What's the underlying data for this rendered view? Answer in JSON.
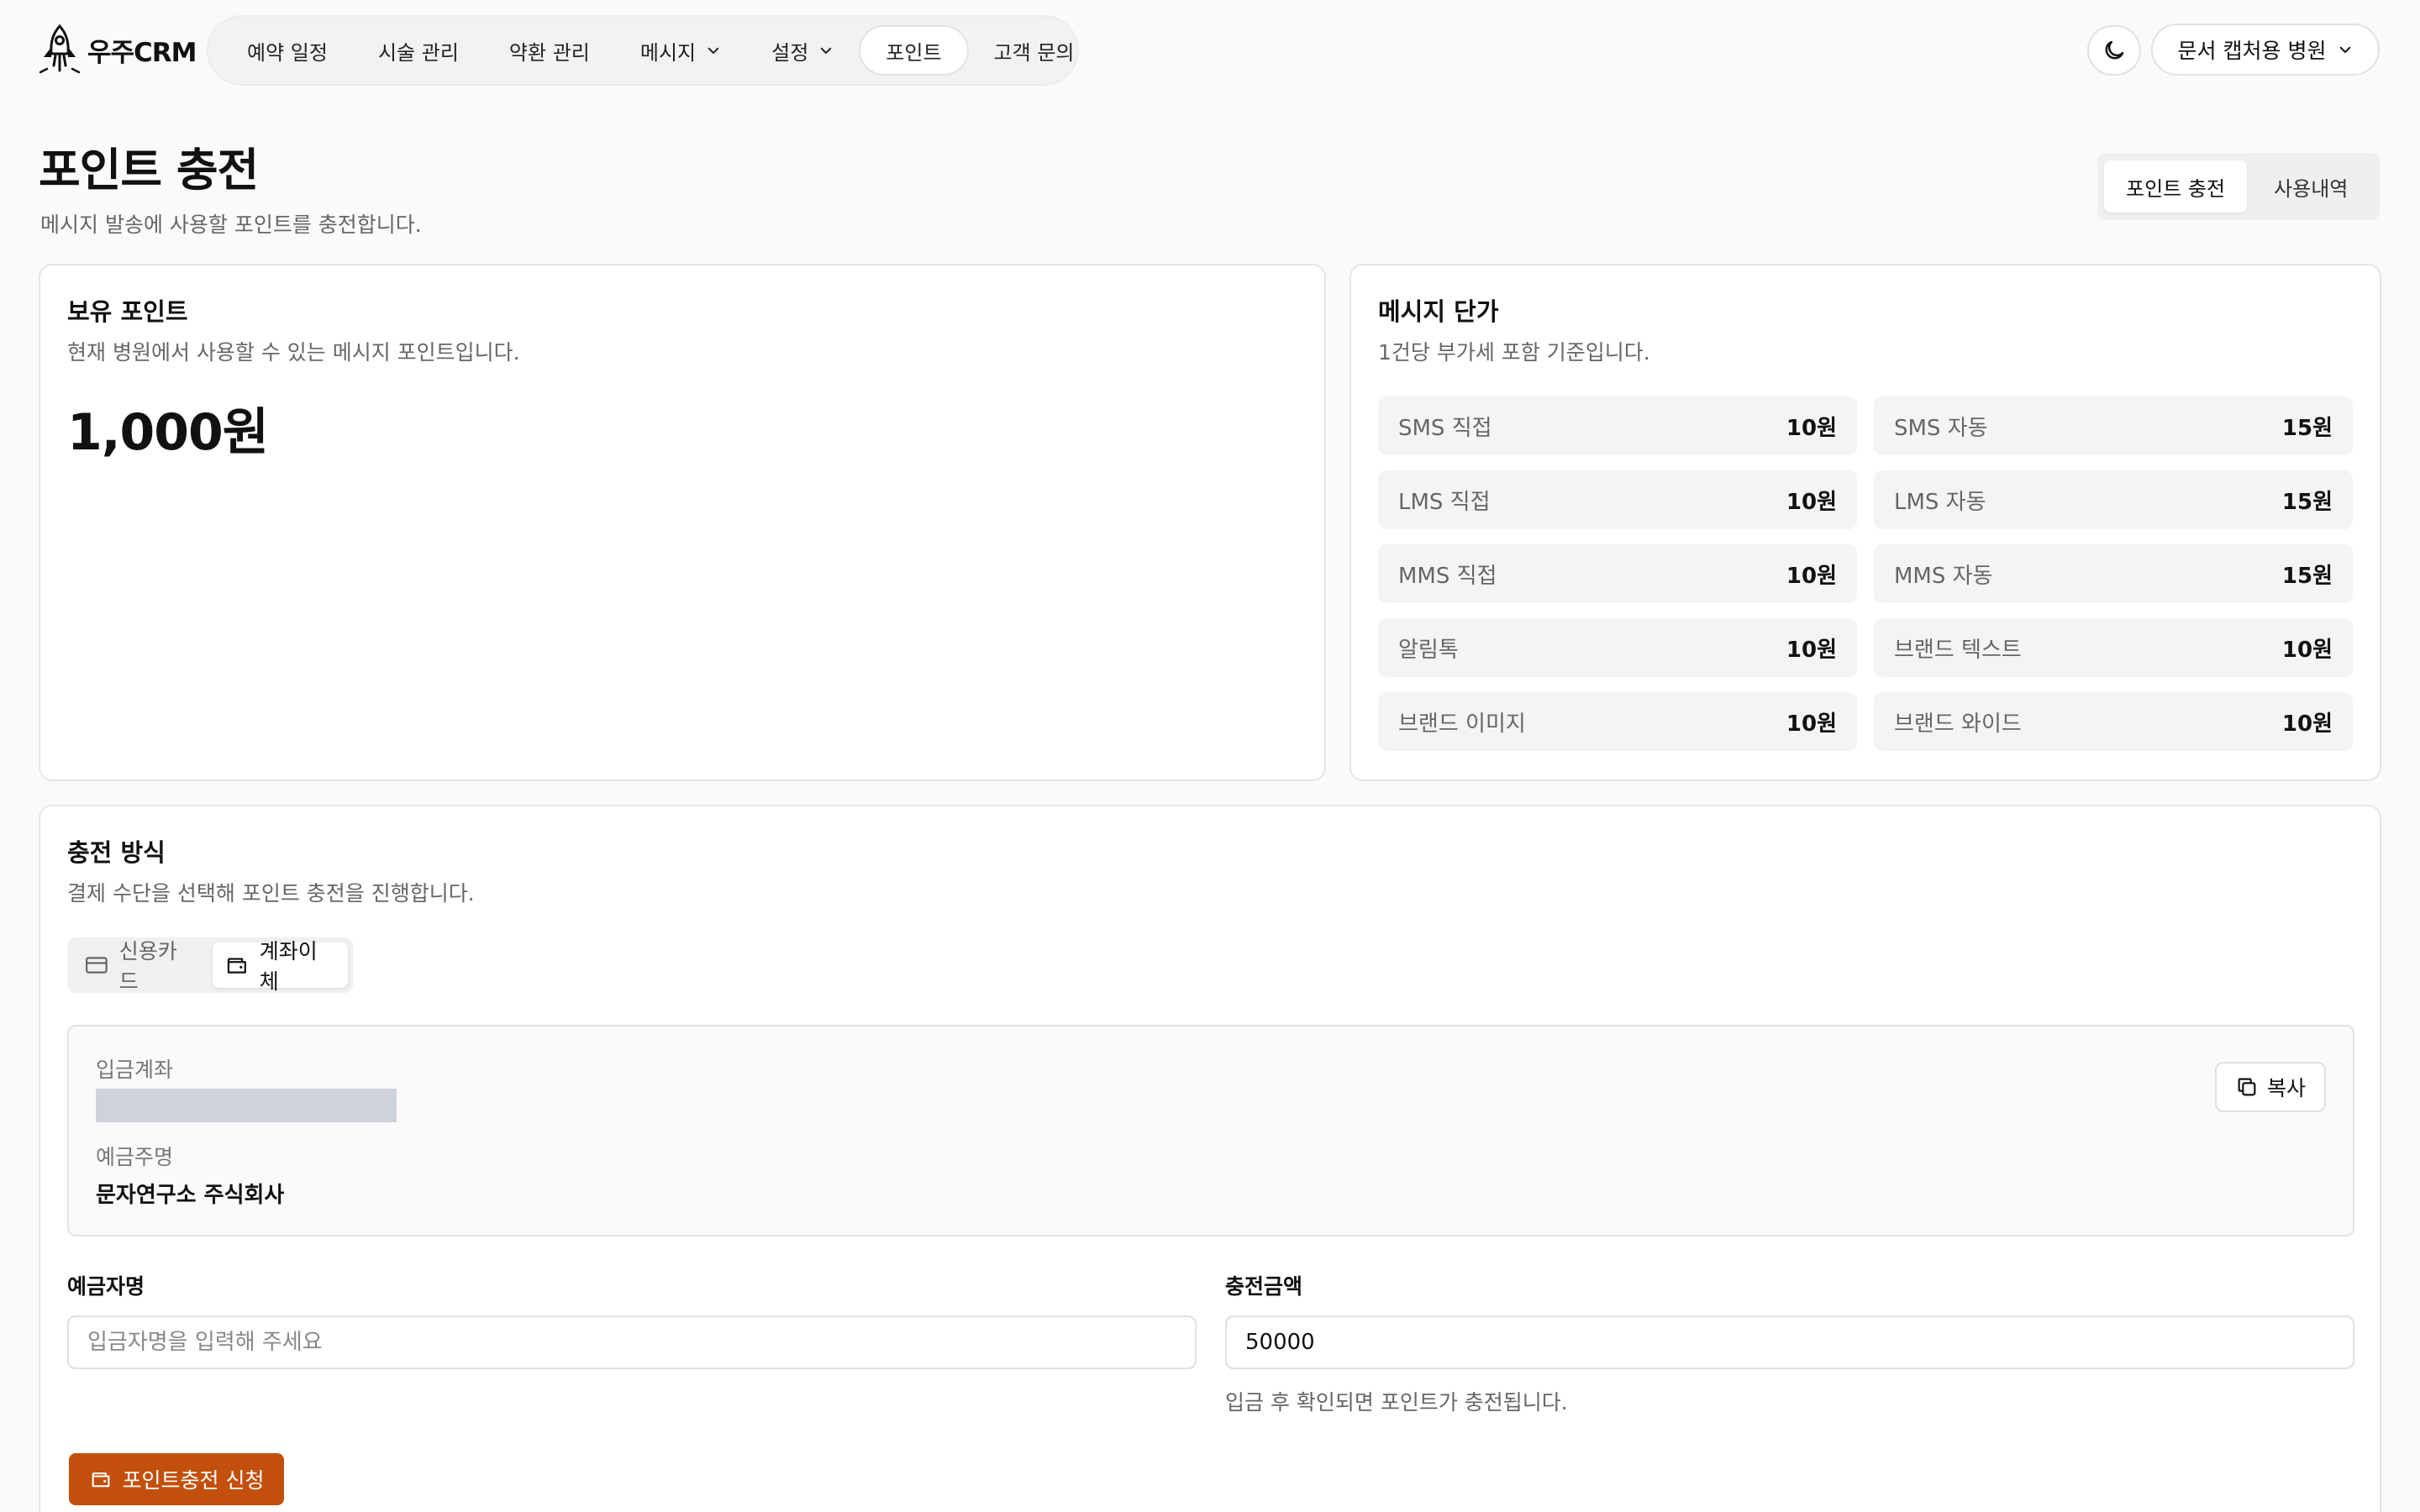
{
  "app": {
    "logo_text": "우주CRM"
  },
  "nav": {
    "items": [
      {
        "label": "예약 일정",
        "active": false,
        "dropdown": false
      },
      {
        "label": "시술 관리",
        "active": false,
        "dropdown": false
      },
      {
        "label": "약환 관리",
        "active": false,
        "dropdown": false
      },
      {
        "label": "메시지",
        "active": false,
        "dropdown": true
      },
      {
        "label": "설정",
        "active": false,
        "dropdown": true
      },
      {
        "label": "포인트",
        "active": true,
        "dropdown": false
      },
      {
        "label": "고객 문의",
        "active": false,
        "dropdown": false
      }
    ],
    "hospital": "문서 캡처용 병원",
    "theme_icon": "moon-icon"
  },
  "header": {
    "title": "포인트 충전",
    "subtitle": "메시지 발송에 사용할 포인트를 충전합니다.",
    "tabs": [
      {
        "label": "포인트 충전",
        "active": true
      },
      {
        "label": "사용내역",
        "active": false
      }
    ]
  },
  "balance_card": {
    "title": "보유 포인트",
    "desc": "현재 병원에서 사용할 수 있는 메시지 포인트입니다.",
    "amount": "1,000원"
  },
  "price_card": {
    "title": "메시지 단가",
    "desc": "1건당 부가세 포함 기준입니다.",
    "items": [
      {
        "label": "SMS 직접",
        "price": "10원"
      },
      {
        "label": "SMS 자동",
        "price": "15원"
      },
      {
        "label": "LMS 직접",
        "price": "10원"
      },
      {
        "label": "LMS 자동",
        "price": "15원"
      },
      {
        "label": "MMS 직접",
        "price": "10원"
      },
      {
        "label": "MMS 자동",
        "price": "15원"
      },
      {
        "label": "알림톡",
        "price": "10원"
      },
      {
        "label": "브랜드 텍스트",
        "price": "10원"
      },
      {
        "label": "브랜드 이미지",
        "price": "10원"
      },
      {
        "label": "브랜드 와이드",
        "price": "10원"
      }
    ]
  },
  "charge_card": {
    "title": "충전 방식",
    "desc": "결제 수단을 선택해 포인트 충전을 진행합니다.",
    "methods": [
      {
        "label": "신용카드",
        "icon": "credit-card-icon",
        "active": false
      },
      {
        "label": "계좌이체",
        "icon": "wallet-icon",
        "active": true
      }
    ],
    "account": {
      "account_label": "입금계좌",
      "holder_label": "예금주명",
      "holder": "문자연구소 주식회사",
      "copy_label": "복사"
    },
    "depositor": {
      "label": "예금자명",
      "placeholder": "입금자명을 입력해 주세요",
      "value": ""
    },
    "amount": {
      "label": "충전금액",
      "value": "50000",
      "help": "입금 후 확인되면 포인트가 충전됩니다."
    },
    "submit_label": "포인트충전 신청"
  },
  "colors": {
    "accent": "#c2500c",
    "redaction": "#cdd2db"
  }
}
